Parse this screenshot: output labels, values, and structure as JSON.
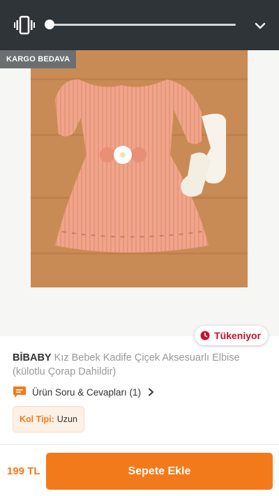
{
  "status_bar": {
    "progress": 0.0,
    "icons": [
      "vibrate-icon",
      "chevron-down-icon"
    ]
  },
  "product": {
    "shipping_badge": "KARGO BEDAVA",
    "stock_label": "Tükeniyor",
    "brand": "BİBABY",
    "name": "Kız Bebek Kadife Çiçek Aksesuarlı Elbise (külotlu Çorap Dahildir)",
    "qa_label": "Ürün Soru & Cevapları (1)",
    "attribute": {
      "key": "Kol Tipi:",
      "value": "Uzun"
    },
    "price": "199 TL",
    "add_to_cart": "Sepete Ekle"
  },
  "colors": {
    "accent": "#f27a1a",
    "stock_red": "#c8102e",
    "top_bar": "#2f3438"
  }
}
